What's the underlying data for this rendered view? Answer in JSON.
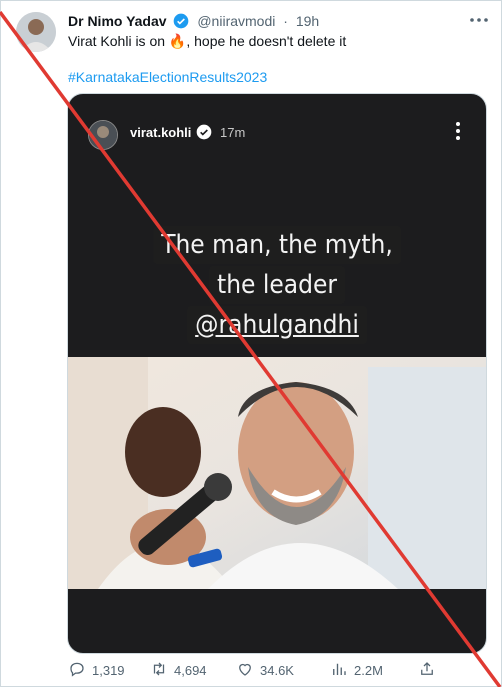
{
  "tweet": {
    "author_name": "Dr Nimo Yadav",
    "handle": "@niiravmodi",
    "separator": "·",
    "time": "19h",
    "text_before": "Virat Kohli is on ",
    "emoji": "🔥",
    "text_after": ", hope he doesn't delete it",
    "hashtag": "#KarnatakaElectionResults2023"
  },
  "story": {
    "username": "virat.kohli",
    "time": "17m",
    "caption_lines": [
      "The man, the myth,",
      "the leader",
      "@rahulgandhi"
    ]
  },
  "actions": {
    "replies": "1,319",
    "retweets": "4,694",
    "likes": "34.6K",
    "views": "2.2M"
  },
  "colors": {
    "accent": "#1d9bf0",
    "cross": "#e03a32",
    "text_secondary": "#536471"
  },
  "icons": [
    "verified-badge-icon",
    "more-options-icon",
    "reply-icon",
    "retweet-icon",
    "like-icon",
    "views-icon",
    "share-icon"
  ]
}
